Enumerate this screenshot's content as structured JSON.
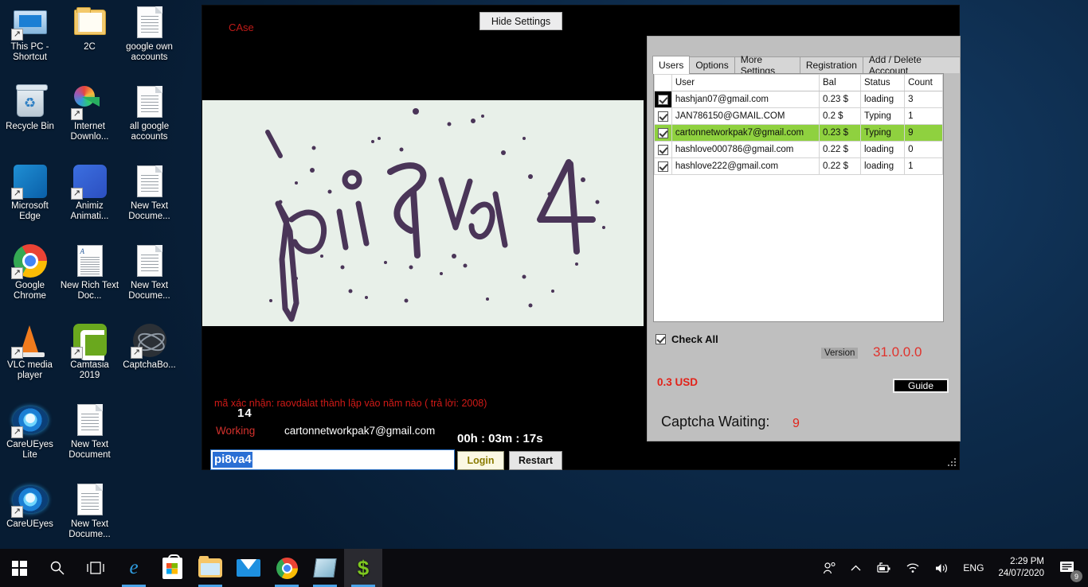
{
  "desktop": {
    "icons": [
      {
        "label": "This PC - Shortcut",
        "icon": "this-pc-icon",
        "art": "ic-pc",
        "shortcut": true
      },
      {
        "label": "2C",
        "icon": "folder-icon",
        "art": "ic-folder",
        "shortcut": false
      },
      {
        "label": "google own accounts",
        "icon": "text-document-icon",
        "art": "ic-doc",
        "shortcut": false
      },
      {
        "label": "Recycle Bin",
        "icon": "recycle-bin-icon",
        "art": "ic-bin",
        "shortcut": false
      },
      {
        "label": "Internet Downlo...",
        "icon": "internet-download-manager-icon",
        "art": "ic-idm",
        "shortcut": true
      },
      {
        "label": "all google accounts",
        "icon": "text-document-icon",
        "art": "ic-doc",
        "shortcut": false
      },
      {
        "label": "Microsoft Edge",
        "icon": "microsoft-edge-icon",
        "art": "ic-edge",
        "shortcut": true
      },
      {
        "label": "Animiz Animati...",
        "icon": "animiz-animation-icon",
        "art": "ic-am",
        "shortcut": true
      },
      {
        "label": "New Text Docume...",
        "icon": "text-document-icon",
        "art": "ic-doc",
        "shortcut": false
      },
      {
        "label": "Google Chrome",
        "icon": "google-chrome-icon",
        "art": "ic-chrome",
        "shortcut": true
      },
      {
        "label": "New Rich Text Doc...",
        "icon": "rich-text-document-icon",
        "art": "ic-rtf",
        "shortcut": false
      },
      {
        "label": "New Text Docume...",
        "icon": "text-document-icon",
        "art": "ic-doc",
        "shortcut": false
      },
      {
        "label": "VLC media player",
        "icon": "vlc-media-player-icon",
        "art": "ic-vlc",
        "shortcut": true
      },
      {
        "label": "Camtasia 2019",
        "icon": "camtasia-icon",
        "art": "ic-cam",
        "shortcut": true
      },
      {
        "label": "CaptchaBo...",
        "icon": "captcha-bot-icon",
        "art": "ic-cb",
        "shortcut": true
      },
      {
        "label": "CareUEyes Lite",
        "icon": "careueyes-icon",
        "art": "ic-eye",
        "shortcut": true
      },
      {
        "label": "New Text Document",
        "icon": "text-document-icon",
        "art": "ic-doc",
        "shortcut": false
      },
      {
        "label": "",
        "icon": "",
        "art": "",
        "shortcut": false
      },
      {
        "label": "CareUEyes",
        "icon": "careueyes-icon",
        "art": "ic-eye",
        "shortcut": true
      },
      {
        "label": "New Text Docume...",
        "icon": "text-document-icon",
        "art": "ic-doc",
        "shortcut": false
      }
    ]
  },
  "app": {
    "case_label": "CAse",
    "hide_settings_label": "Hide Settings",
    "captcha_text": "pi8va4",
    "captcha_question": "mã xác nhận: raovdalat thành lập vào năm nào ( trả lời: 2008)",
    "count_14": "14",
    "working_label": "Working",
    "working_email": "cartonnetworkpak7@gmail.com",
    "timer": "00h : 03m : 17s",
    "captcha_input_value": "pi8va4",
    "login_label": "Login",
    "restart_label": "Restart",
    "colors": {
      "working_red": "#d4312c",
      "question_red": "#d01a17",
      "login_text": "#8a7b00"
    }
  },
  "settings": {
    "tabs": [
      {
        "label": "Users",
        "active": true
      },
      {
        "label": "Options",
        "active": false
      },
      {
        "label": "More Settings",
        "active": false
      },
      {
        "label": "Registration",
        "active": false
      },
      {
        "label": "Add / Delete Acccount",
        "active": false
      }
    ],
    "grid": {
      "columns": [
        "",
        "User",
        "Bal",
        "Status",
        "Count"
      ],
      "rows": [
        {
          "checked": true,
          "user": "hashjan07@gmail.com",
          "bal": "0.23 $",
          "status": "loading",
          "count": "3",
          "selected": false,
          "chk_focus": true
        },
        {
          "checked": true,
          "user": "JAN786150@GMAIL.COM",
          "bal": "0.2 $",
          "status": "Typing",
          "count": "1",
          "selected": false,
          "chk_focus": false
        },
        {
          "checked": true,
          "user": "cartonnetworkpak7@gmail.com",
          "bal": "0.23 $",
          "status": "Typing",
          "count": "9",
          "selected": true,
          "chk_focus": false
        },
        {
          "checked": true,
          "user": "hashlove000786@gmail.com",
          "bal": "0.22 $",
          "status": "loading",
          "count": "0",
          "selected": false,
          "chk_focus": false
        },
        {
          "checked": true,
          "user": "hashlove222@gmail.com",
          "bal": "0.22 $",
          "status": "loading",
          "count": "1",
          "selected": false,
          "chk_focus": false
        }
      ],
      "row_highlight_color": "#8fd13f"
    },
    "check_all_label": "Check All",
    "check_all_checked": true,
    "version_label": "Version",
    "version_value": "31.0.0.0",
    "usd_value": "0.3 USD",
    "guide_label": "Guide",
    "captcha_waiting_label": "Captcha Waiting:",
    "captcha_waiting_value": "9"
  },
  "taskbar": {
    "buttons": [
      {
        "name": "start-button",
        "icon": "windows-logo-icon"
      },
      {
        "name": "search-button",
        "icon": "search-icon"
      },
      {
        "name": "task-view-button",
        "icon": "task-view-icon"
      },
      {
        "name": "edge-button",
        "icon": "microsoft-edge-icon"
      },
      {
        "name": "microsoft-store-button",
        "icon": "microsoft-store-icon"
      },
      {
        "name": "file-explorer-button",
        "icon": "file-explorer-icon"
      },
      {
        "name": "mail-button",
        "icon": "mail-icon"
      },
      {
        "name": "chrome-button",
        "icon": "google-chrome-icon"
      },
      {
        "name": "notepad-button",
        "icon": "notepad-icon"
      },
      {
        "name": "captcha-app-button",
        "icon": "dollar-icon"
      }
    ],
    "tray": {
      "people_icon": "people-icon",
      "chevron_icon": "show-hidden-icons-icon",
      "battery_icon": "battery-icon",
      "network_icon": "wifi-icon",
      "volume_icon": "volume-icon",
      "language": "ENG",
      "time": "2:29 PM",
      "date": "24/07/2020",
      "notification_count": "9"
    }
  }
}
